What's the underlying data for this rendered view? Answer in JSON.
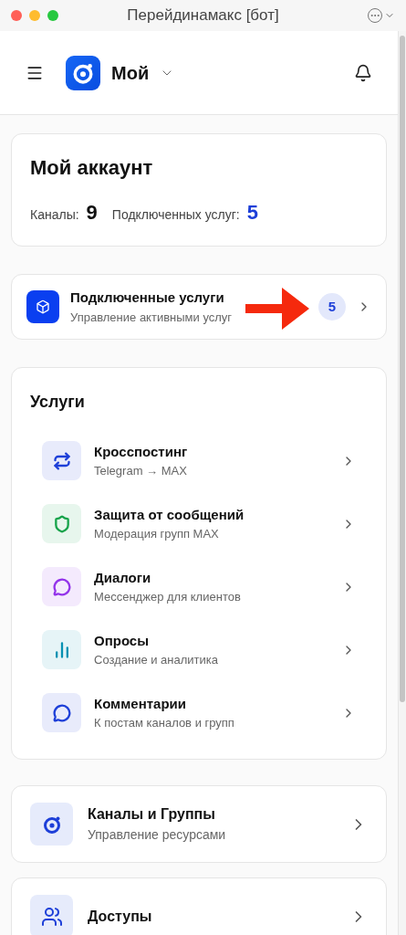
{
  "window": {
    "title": "Перейдинамакс [бот]"
  },
  "header": {
    "workspace": "Мой"
  },
  "account": {
    "title": "Мой аккаунт",
    "stats": [
      {
        "label": "Каналы:",
        "value": "9",
        "accent": false
      },
      {
        "label": "Подключенных услуг:",
        "value": "5",
        "accent": true
      }
    ]
  },
  "connected": {
    "title": "Подключенные услуги",
    "subtitle": "Управление активными услуг",
    "count": "5"
  },
  "services": {
    "title": "Услуги",
    "items": [
      {
        "kind": "repost",
        "title": "Кросспостинг",
        "subtitle": "Telegram → MAX",
        "color": "#1d3fd8"
      },
      {
        "kind": "shield",
        "title": "Защита от сообщений",
        "subtitle": "Модерация групп MAX",
        "color": "#16a34a"
      },
      {
        "kind": "chat",
        "title": "Диалоги",
        "subtitle": "Мессенджер для клиентов",
        "color": "#9333ea"
      },
      {
        "kind": "chart",
        "title": "Опросы",
        "subtitle": "Создание и аналитика",
        "color": "#0891b2"
      },
      {
        "kind": "chat",
        "title": "Комментарии",
        "subtitle": "К постам каналов и групп",
        "color": "#1d3fd8"
      }
    ]
  },
  "links": [
    {
      "kind": "logo",
      "title": "Каналы и Группы",
      "subtitle": "Управление ресурсами"
    },
    {
      "kind": "users",
      "title": "Доступы"
    }
  ]
}
